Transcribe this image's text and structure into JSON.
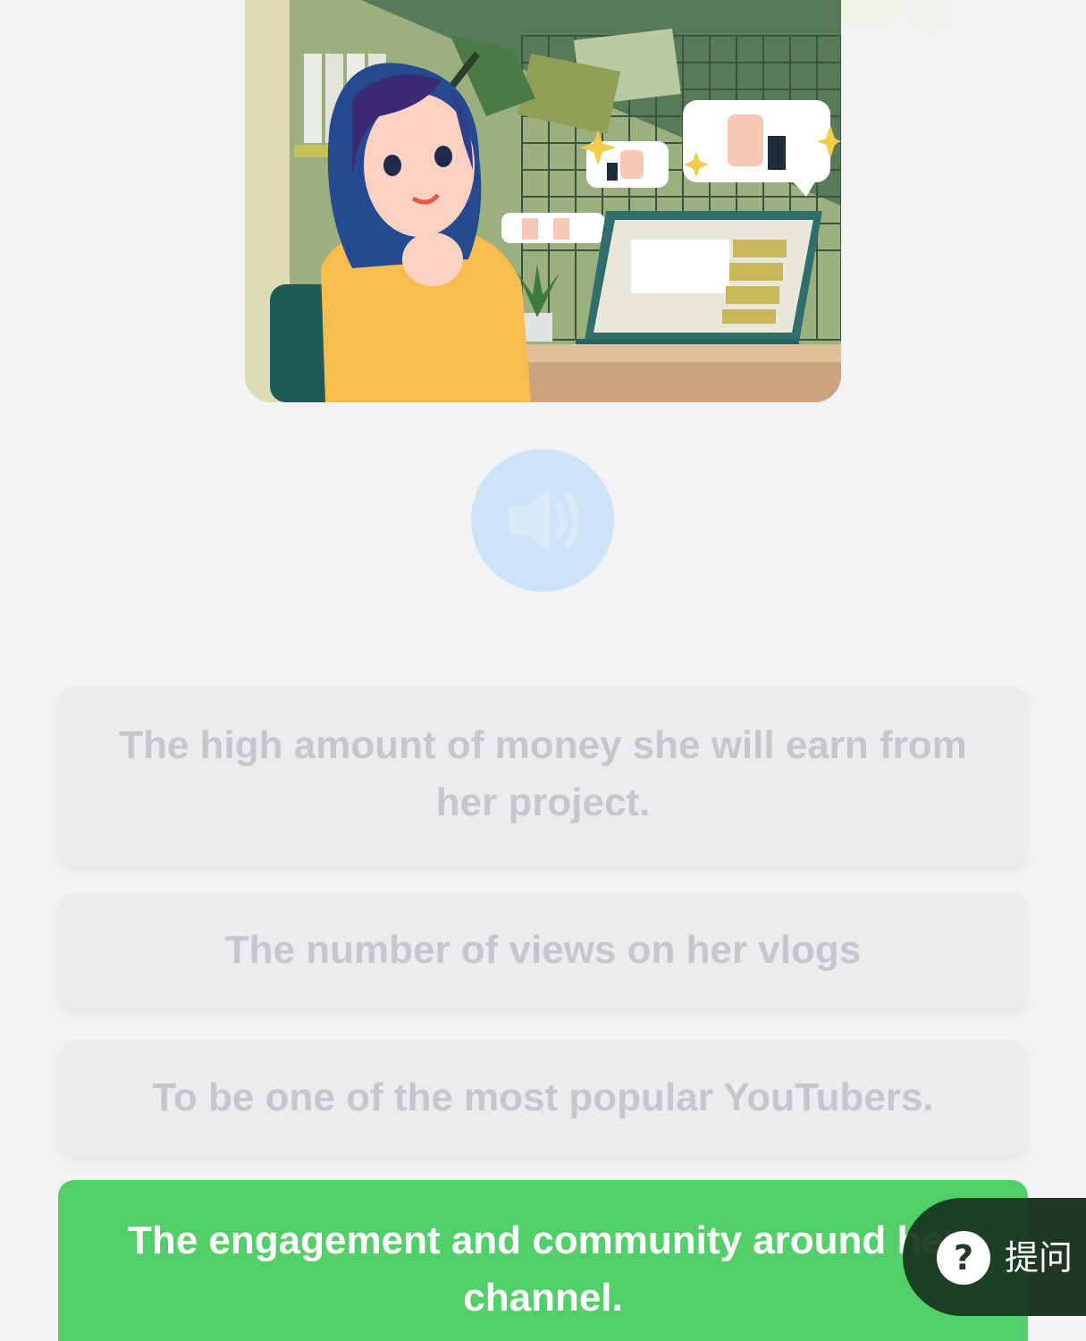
{
  "illustration": {
    "icon": "woman-vlogger-illustration"
  },
  "audio": {
    "icon": "speaker-icon"
  },
  "options": [
    {
      "text": "The high amount of money she will earn from her project."
    },
    {
      "text": "The number of views on her vlogs"
    },
    {
      "text": "To be one of the most popular YouTubers."
    },
    {
      "text": "The engagement and community around her channel."
    }
  ],
  "ask_button": {
    "icon": "question-mark",
    "symbol": "?",
    "label": "提问"
  },
  "colors": {
    "background": "#f2f3f5",
    "option_bg": "#ececee",
    "option_text": "#c6c7cc",
    "selected_bg": "#52cf69",
    "selected_text": "#ffffff",
    "audio_bg": "#cde3f8"
  }
}
